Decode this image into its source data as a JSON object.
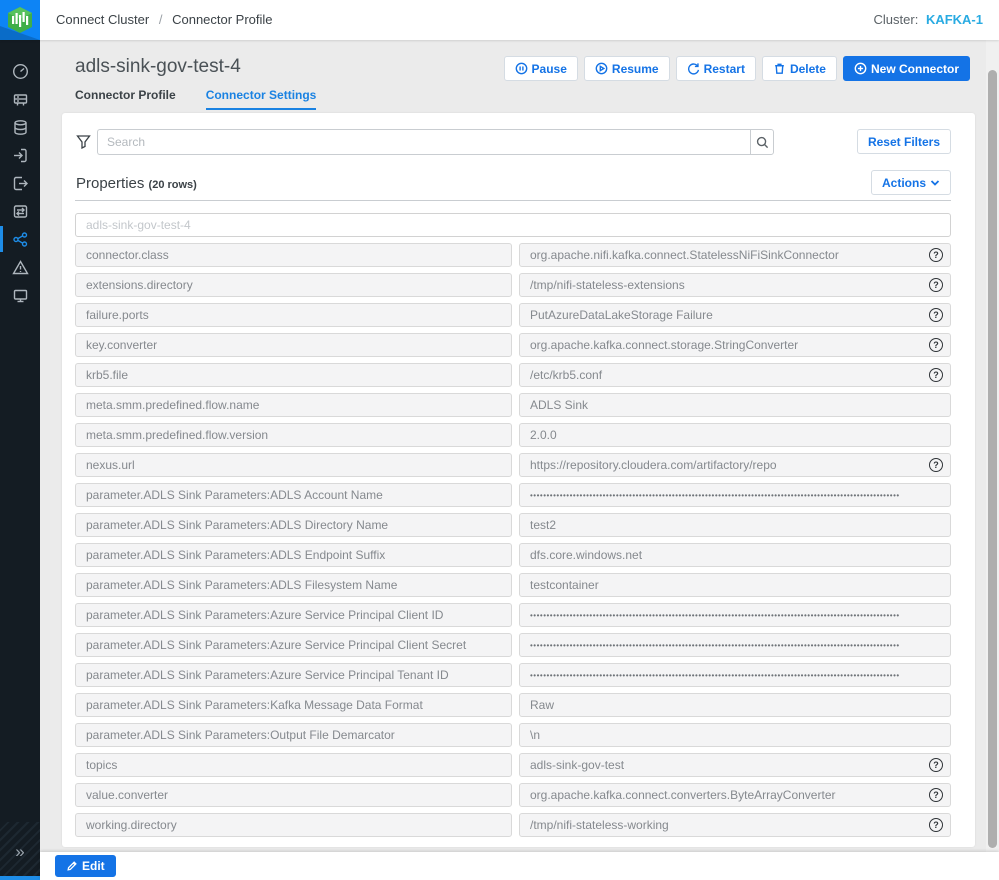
{
  "header": {
    "breadcrumb": {
      "part1": "Connect Cluster",
      "separator": "/",
      "part2": "Connector Profile"
    },
    "cluster_label": "Cluster:",
    "cluster_name": "KAFKA-1"
  },
  "sidebar": {
    "items": [
      "overview",
      "brokers",
      "topics",
      "producers",
      "consumers",
      "replications",
      "connect",
      "alerts",
      "monitoring"
    ],
    "active_item": "connect",
    "collapse_icon": "»"
  },
  "page": {
    "title": "adls-sink-gov-test-4",
    "tabs": [
      {
        "label": "Connector Profile",
        "active": false
      },
      {
        "label": "Connector Settings",
        "active": true
      }
    ],
    "buttons": {
      "pause": "Pause",
      "resume": "Resume",
      "restart": "Restart",
      "delete": "Delete",
      "new_connector": "New Connector"
    }
  },
  "toolbar": {
    "search_placeholder": "Search",
    "reset_filters": "Reset Filters"
  },
  "properties": {
    "title": "Properties",
    "count_label": "(20 rows)",
    "actions_label": "Actions",
    "name_placeholder": "adls-sink-gov-test-4",
    "help_glyph": "?",
    "masked_char": "•",
    "masked_count": 112,
    "rows": [
      {
        "key": "connector.class",
        "value": "org.apache.nifi.kafka.connect.StatelessNiFiSinkConnector",
        "masked": false,
        "help": true
      },
      {
        "key": "extensions.directory",
        "value": "/tmp/nifi-stateless-extensions",
        "masked": false,
        "help": true
      },
      {
        "key": "failure.ports",
        "value": "PutAzureDataLakeStorage Failure",
        "masked": false,
        "help": true
      },
      {
        "key": "key.converter",
        "value": "org.apache.kafka.connect.storage.StringConverter",
        "masked": false,
        "help": true
      },
      {
        "key": "krb5.file",
        "value": "/etc/krb5.conf",
        "masked": false,
        "help": true
      },
      {
        "key": "meta.smm.predefined.flow.name",
        "value": "ADLS Sink",
        "masked": false,
        "help": false
      },
      {
        "key": "meta.smm.predefined.flow.version",
        "value": "2.0.0",
        "masked": false,
        "help": false
      },
      {
        "key": "nexus.url",
        "value": "https://repository.cloudera.com/artifactory/repo",
        "masked": false,
        "help": true
      },
      {
        "key": "parameter.ADLS Sink Parameters:ADLS Account Name",
        "value": "",
        "masked": true,
        "help": false
      },
      {
        "key": "parameter.ADLS Sink Parameters:ADLS Directory Name",
        "value": "test2",
        "masked": false,
        "help": false
      },
      {
        "key": "parameter.ADLS Sink Parameters:ADLS Endpoint Suffix",
        "value": "dfs.core.windows.net",
        "masked": false,
        "help": false
      },
      {
        "key": "parameter.ADLS Sink Parameters:ADLS Filesystem Name",
        "value": "testcontainer",
        "masked": false,
        "help": false
      },
      {
        "key": "parameter.ADLS Sink Parameters:Azure Service Principal Client ID",
        "value": "",
        "masked": true,
        "help": false
      },
      {
        "key": "parameter.ADLS Sink Parameters:Azure Service Principal Client Secret",
        "value": "",
        "masked": true,
        "help": false
      },
      {
        "key": "parameter.ADLS Sink Parameters:Azure Service Principal Tenant ID",
        "value": "",
        "masked": true,
        "help": false
      },
      {
        "key": "parameter.ADLS Sink Parameters:Kafka Message Data Format",
        "value": "Raw",
        "masked": false,
        "help": false
      },
      {
        "key": "parameter.ADLS Sink Parameters:Output File Demarcator",
        "value": "\\n",
        "masked": false,
        "help": false
      },
      {
        "key": "topics",
        "value": "adls-sink-gov-test",
        "masked": false,
        "help": true
      },
      {
        "key": "value.converter",
        "value": "org.apache.kafka.connect.converters.ByteArrayConverter",
        "masked": false,
        "help": true
      },
      {
        "key": "working.directory",
        "value": "/tmp/nifi-stateless-working",
        "masked": false,
        "help": true
      }
    ]
  },
  "footer": {
    "edit_label": "Edit"
  },
  "colors": {
    "accent_blue": "#1473e6",
    "tab_blue": "#1a82e2",
    "cluster_cyan": "#29abe2",
    "sidebar_bg": "#141c23",
    "page_bg": "#ebebeb",
    "field_bg": "#f4f4f5"
  }
}
